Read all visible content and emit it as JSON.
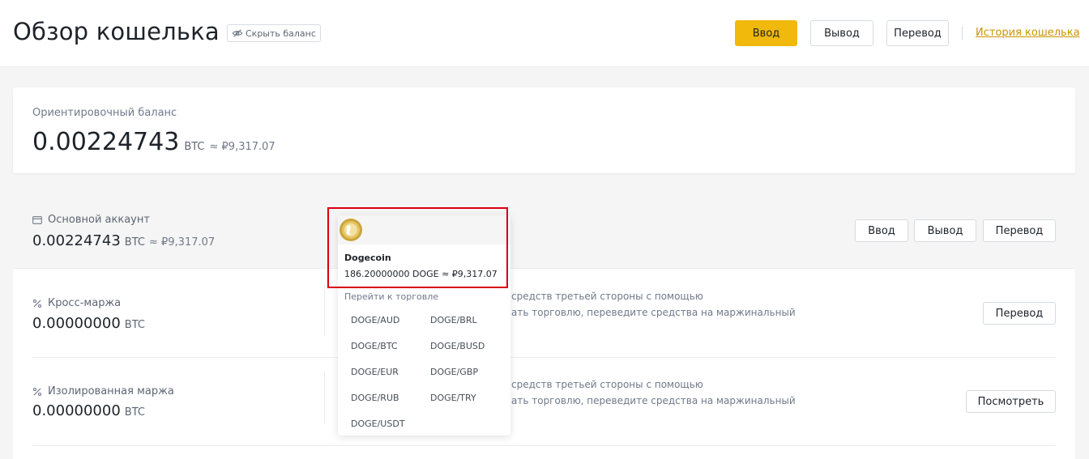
{
  "header": {
    "title": "Обзор кошелька",
    "hide_balance": "Скрыть баланс",
    "deposit": "Ввод",
    "withdraw": "Вывод",
    "transfer": "Перевод",
    "history": "История кошелька"
  },
  "estimated": {
    "label": "Ориентировочный баланс",
    "value": "0.00224743",
    "unit": "BTC",
    "approx": "≈ ₽9,317.07"
  },
  "main_account": {
    "label": "Основной аккаунт",
    "value": "0.00224743",
    "unit": "BTC",
    "approx": "≈ ₽9,317.07",
    "deposit": "Ввод",
    "withdraw": "Вывод",
    "transfer": "Перевод"
  },
  "cross_margin": {
    "label": "Кросс-маржа",
    "value": "0.00000000",
    "unit": "BTC",
    "desc_line1": "средств третьей стороны с помощью",
    "desc_line2": "ать торговлю, переведите средства на маржинальный",
    "button": "Перевод"
  },
  "isolated_margin": {
    "label": "Изолированная маржа",
    "value": "0.00000000",
    "unit": "BTC",
    "desc_line1": "средств третьей стороны с помощью",
    "desc_line2": "ать торговлю, переведите средства на маржинальный",
    "button": "Посмотреть"
  },
  "popup": {
    "coin_name": "Dogecoin",
    "amount": "186.20000000 DOGE ≈ ₽9,317.07",
    "goto_label": "Перейти к торговле",
    "pairs": [
      "DOGE/AUD",
      "DOGE/BRL",
      "DOGE/BTC",
      "DOGE/BUSD",
      "DOGE/EUR",
      "DOGE/GBP",
      "DOGE/RUB",
      "DOGE/TRY",
      "DOGE/USDT"
    ]
  },
  "colors": {
    "accent": "#f0b90b",
    "link": "#c99400",
    "highlight": "#d9000d"
  }
}
